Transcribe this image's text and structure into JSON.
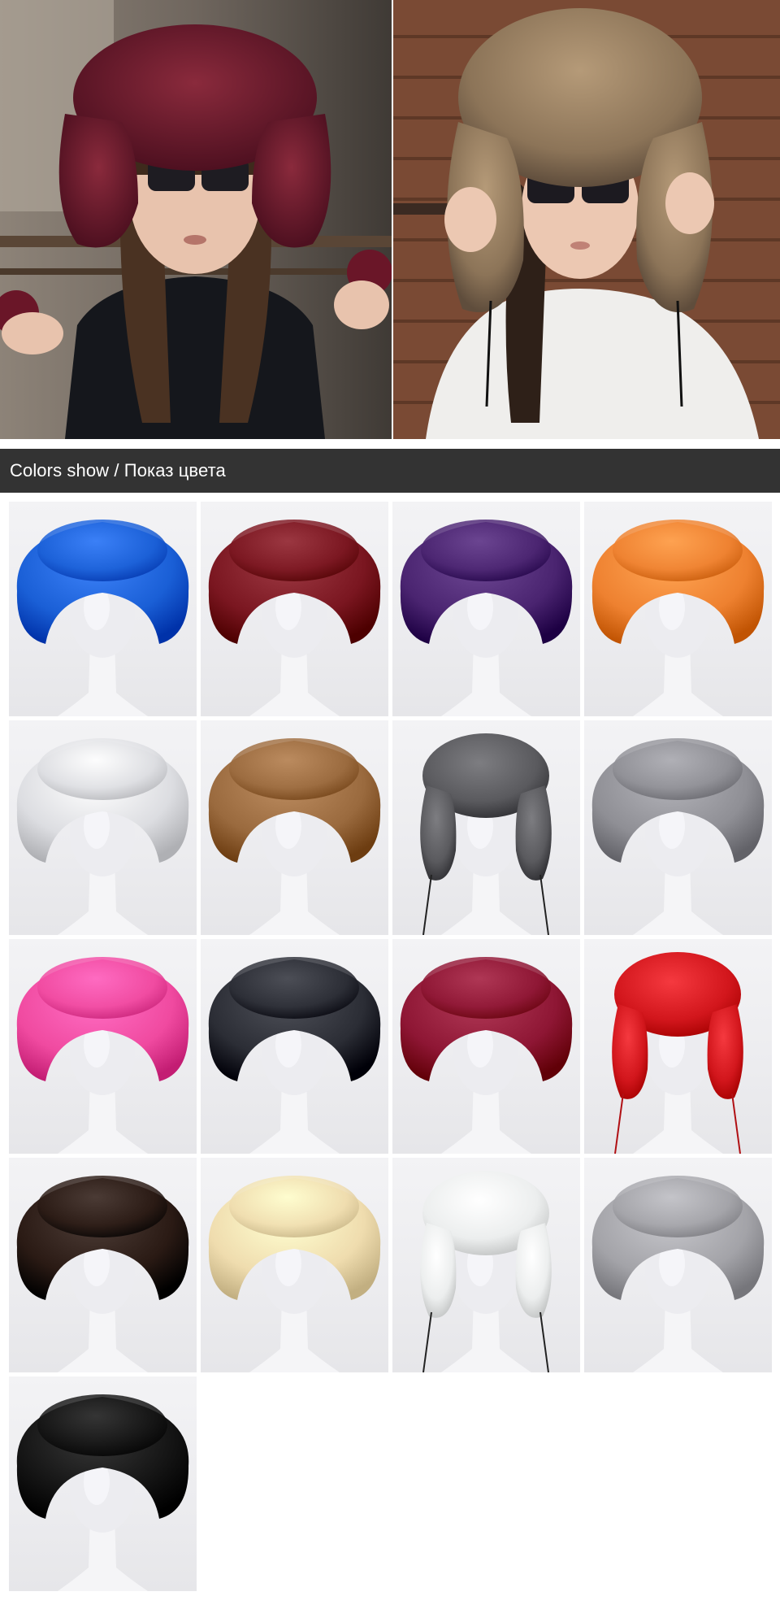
{
  "section_header": {
    "title": "Colors show / Показ цвета"
  },
  "hero": {
    "left_photo_icon": "child-wearing-burgundy-fur-trapper-hat-photo",
    "right_photo_icon": "child-wearing-raccoon-fur-trapper-hat-photo",
    "left_hat_color": "#6e1a2c",
    "right_hat_color": "#a48766"
  },
  "swatches": [
    {
      "color": "#1a5fd6",
      "style": "bowl",
      "icon": "blue-fur-hat-photo"
    },
    {
      "color": "#7a1620",
      "style": "bowl",
      "icon": "dark-red-fur-hat-photo"
    },
    {
      "color": "#4a2470",
      "style": "bowl",
      "icon": "purple-fur-hat-photo"
    },
    {
      "color": "#ee8130",
      "style": "bowl",
      "icon": "orange-fur-hat-photo"
    },
    {
      "color": "#dcdde1",
      "style": "bowl",
      "icon": "white-fox-fur-hat-photo"
    },
    {
      "color": "#9a6a3e",
      "style": "bowl",
      "icon": "raccoon-fur-hat-photo"
    },
    {
      "color": "#5a5a5e",
      "style": "trapper",
      "icon": "silver-fox-trapper-hat-photo"
    },
    {
      "color": "#8f8f95",
      "style": "bowl",
      "icon": "grey-fur-hat-photo"
    },
    {
      "color": "#f04aa0",
      "style": "bowl",
      "icon": "pink-fur-hat-photo"
    },
    {
      "color": "#2b2d35",
      "style": "bowl",
      "icon": "dark-grey-fur-hat-photo"
    },
    {
      "color": "#8e1634",
      "style": "bowl",
      "icon": "wine-red-fur-hat-photo"
    },
    {
      "color": "#d2161c",
      "style": "trapper",
      "icon": "red-trapper-hat-photo"
    },
    {
      "color": "#2a1a14",
      "style": "bowl",
      "icon": "dark-brown-fur-hat-photo"
    },
    {
      "color": "#efdcae",
      "style": "bowl",
      "icon": "beige-fur-hat-photo"
    },
    {
      "color": "#eceeee",
      "style": "trapper",
      "icon": "white-trapper-hat-photo"
    },
    {
      "color": "#a3a3a8",
      "style": "bowl",
      "icon": "light-grey-fur-hat-photo"
    },
    {
      "color": "#141414",
      "style": "bowl",
      "icon": "black-fur-hat-photo"
    }
  ]
}
